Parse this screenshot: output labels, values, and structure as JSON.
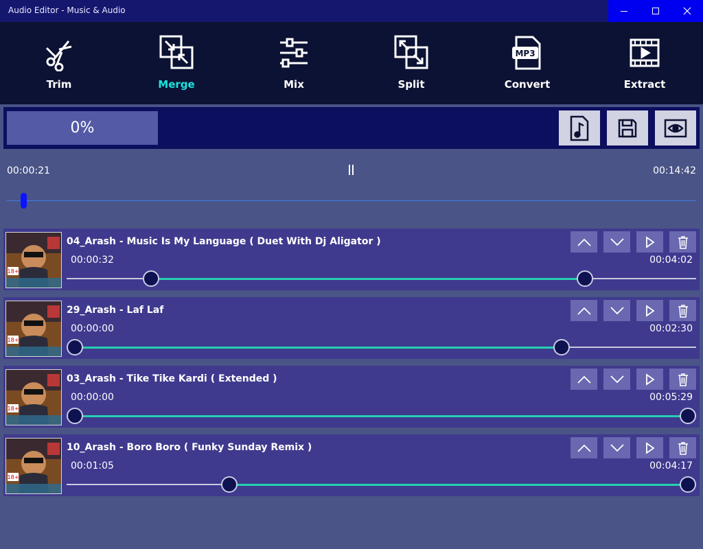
{
  "window": {
    "title": "Audio Editor - Music & Audio"
  },
  "toolbar": {
    "items": [
      {
        "label": "Trim",
        "icon": "scissors-icon"
      },
      {
        "label": "Merge",
        "icon": "merge-icon",
        "active": true
      },
      {
        "label": "Mix",
        "icon": "sliders-icon"
      },
      {
        "label": "Split",
        "icon": "split-icon"
      },
      {
        "label": "Convert",
        "icon": "mp3-file-icon"
      },
      {
        "label": "Extract",
        "icon": "film-icon"
      }
    ]
  },
  "progress": {
    "label": "0%",
    "value": 0
  },
  "player": {
    "current": "00:00:21",
    "total": "00:14:42",
    "position_fraction": 0.024
  },
  "tracks": [
    {
      "title": "04_Arash - Music Is My Language ( Duet With Dj Aligator )",
      "start": "00:00:32",
      "end": "00:04:02",
      "range_start_fraction": 0.124,
      "range_end_fraction": 0.832
    },
    {
      "title": "29_Arash - Laf Laf",
      "start": "00:00:00",
      "end": "00:02:30",
      "range_start_fraction": 0.0,
      "range_end_fraction": 0.794
    },
    {
      "title": "03_Arash - Tike Tike Kardi ( Extended )",
      "start": "00:00:00",
      "end": "00:05:29",
      "range_start_fraction": 0.0,
      "range_end_fraction": 1.0
    },
    {
      "title": "10_Arash - Boro Boro ( Funky Sunday Remix )",
      "start": "00:01:05",
      "end": "00:04:17",
      "range_start_fraction": 0.252,
      "range_end_fraction": 1.0
    }
  ],
  "colors": {
    "accent": "#19e5e0",
    "selection": "#27d0b0",
    "title_bar": "#15176e",
    "toolbar": "#0c1233",
    "background": "#4a5486"
  }
}
